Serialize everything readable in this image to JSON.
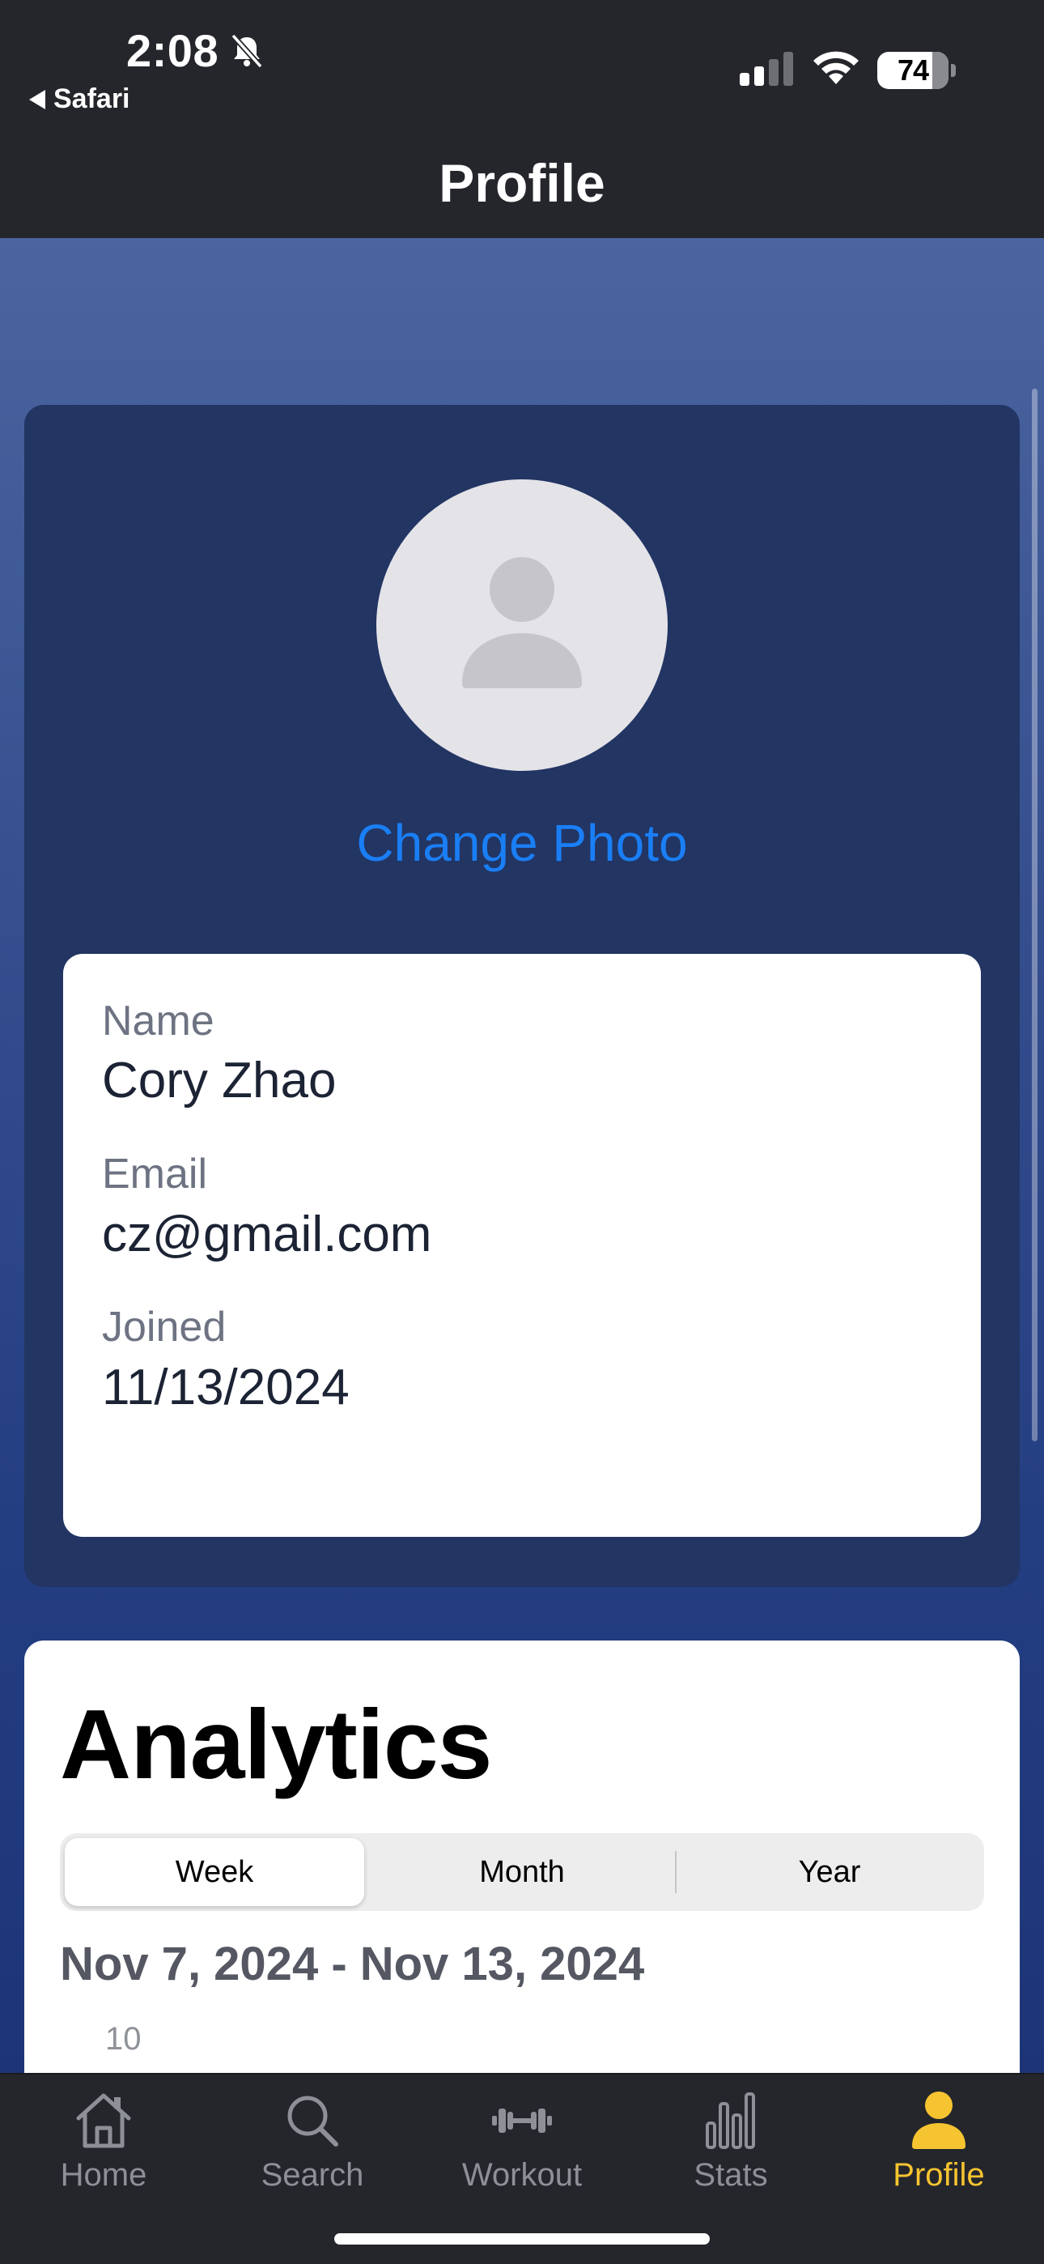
{
  "status_bar": {
    "time": "2:08",
    "back_app": "Safari",
    "battery": "74"
  },
  "header": {
    "title": "Profile"
  },
  "profile": {
    "change_photo": "Change Photo",
    "fields": [
      {
        "label": "Name",
        "value": "Cory Zhao"
      },
      {
        "label": "Email",
        "value": "cz@gmail.com"
      },
      {
        "label": "Joined",
        "value": "11/13/2024"
      }
    ]
  },
  "analytics": {
    "title": "Analytics",
    "segments": [
      "Week",
      "Month",
      "Year"
    ],
    "selected_segment": "Week",
    "date_range": "Nov 7, 2024 - Nov 13, 2024",
    "axis_peek": "10"
  },
  "tabs": [
    {
      "label": "Home",
      "icon": "home-icon"
    },
    {
      "label": "Search",
      "icon": "search-icon"
    },
    {
      "label": "Workout",
      "icon": "dumbbell-icon"
    },
    {
      "label": "Stats",
      "icon": "bar-chart-icon"
    },
    {
      "label": "Profile",
      "icon": "person-icon"
    }
  ],
  "colors": {
    "accent": "#1a7ef5",
    "active_tab": "#f7c431",
    "inactive_tab": "#8e9098"
  }
}
